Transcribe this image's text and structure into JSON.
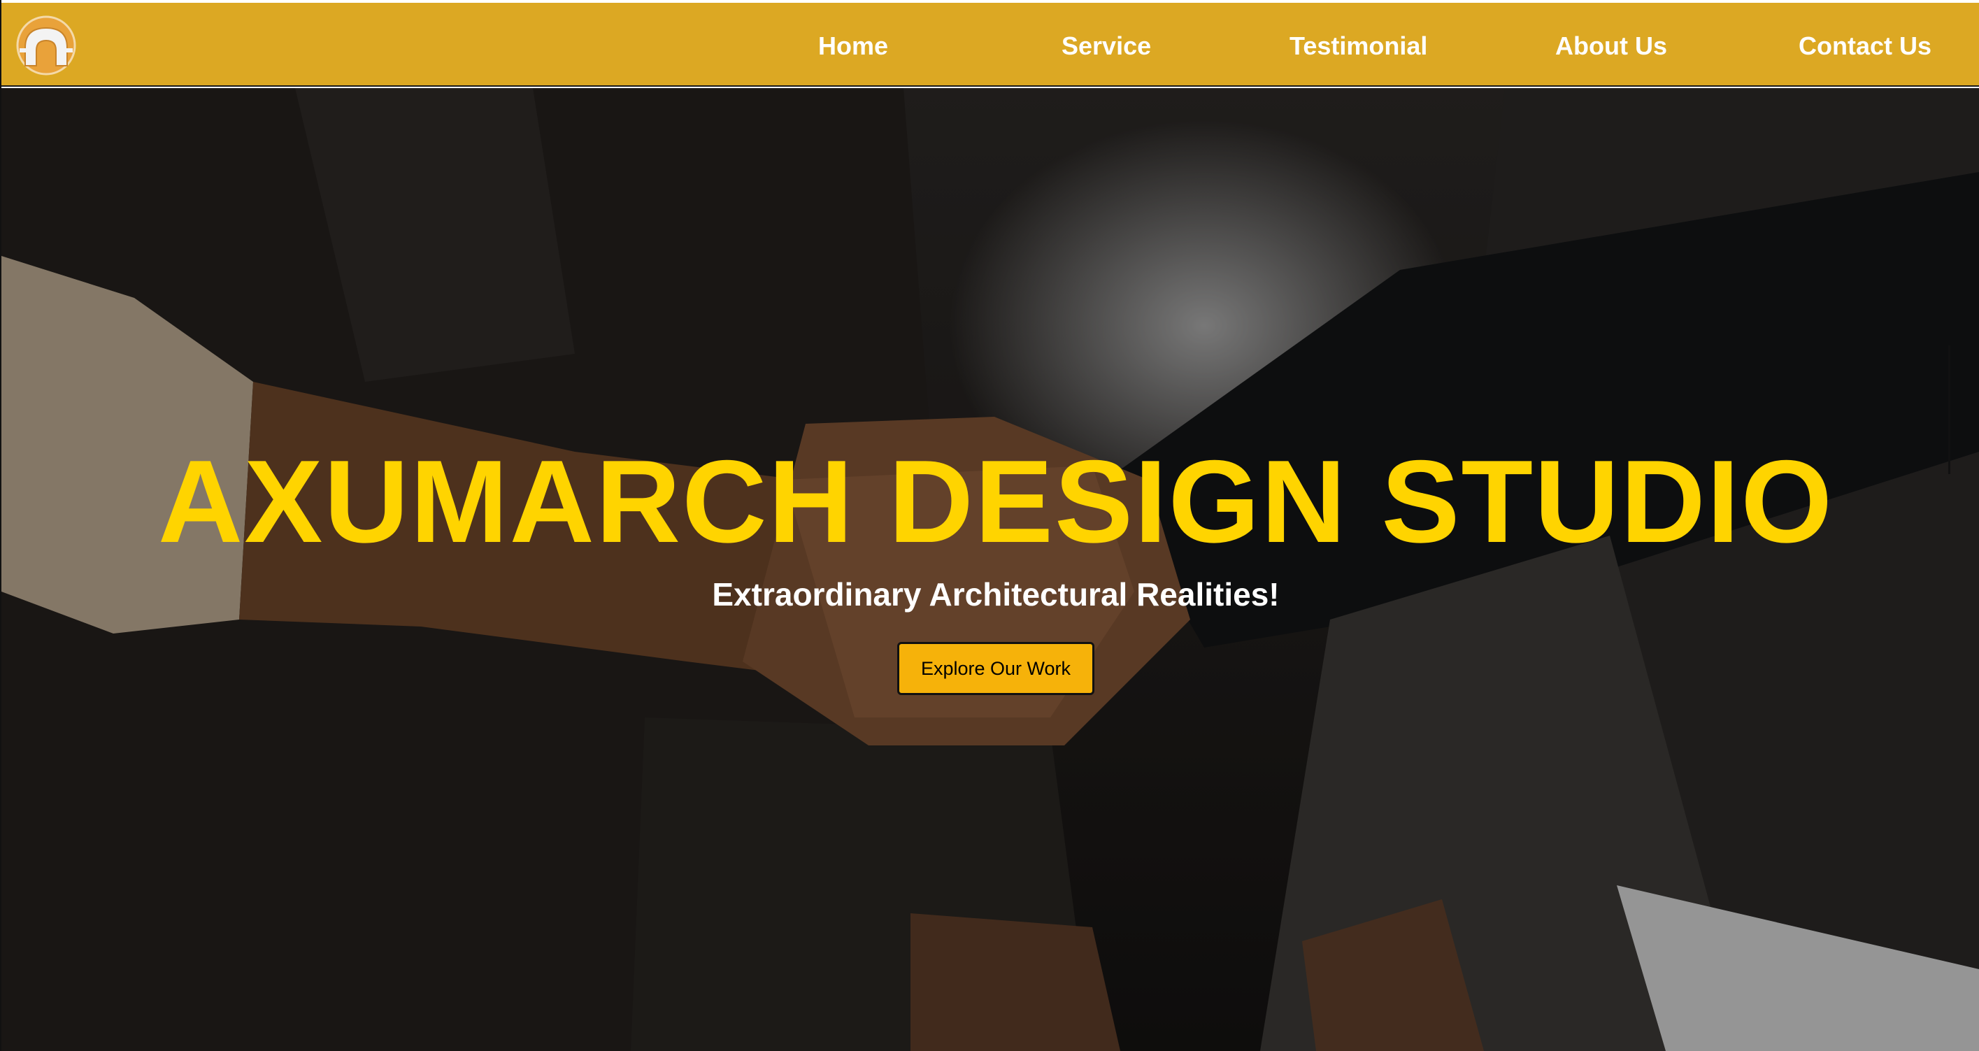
{
  "brand": {
    "logo_icon": "arch-logo-icon",
    "accent_color": "#dca823",
    "title_color": "#ffd400",
    "button_color": "#f6b20a"
  },
  "nav": {
    "items": [
      {
        "label": "Home"
      },
      {
        "label": "Service"
      },
      {
        "label": "Testimonial"
      },
      {
        "label": "About Us"
      },
      {
        "label": "Contact Us"
      }
    ]
  },
  "hero": {
    "background_icon": "handshake-photo",
    "title": "AXUMARCH DESIGN STUDIO",
    "subtitle": "Extraordinary Architectural Realities!",
    "cta_label": "Explore Our Work"
  }
}
